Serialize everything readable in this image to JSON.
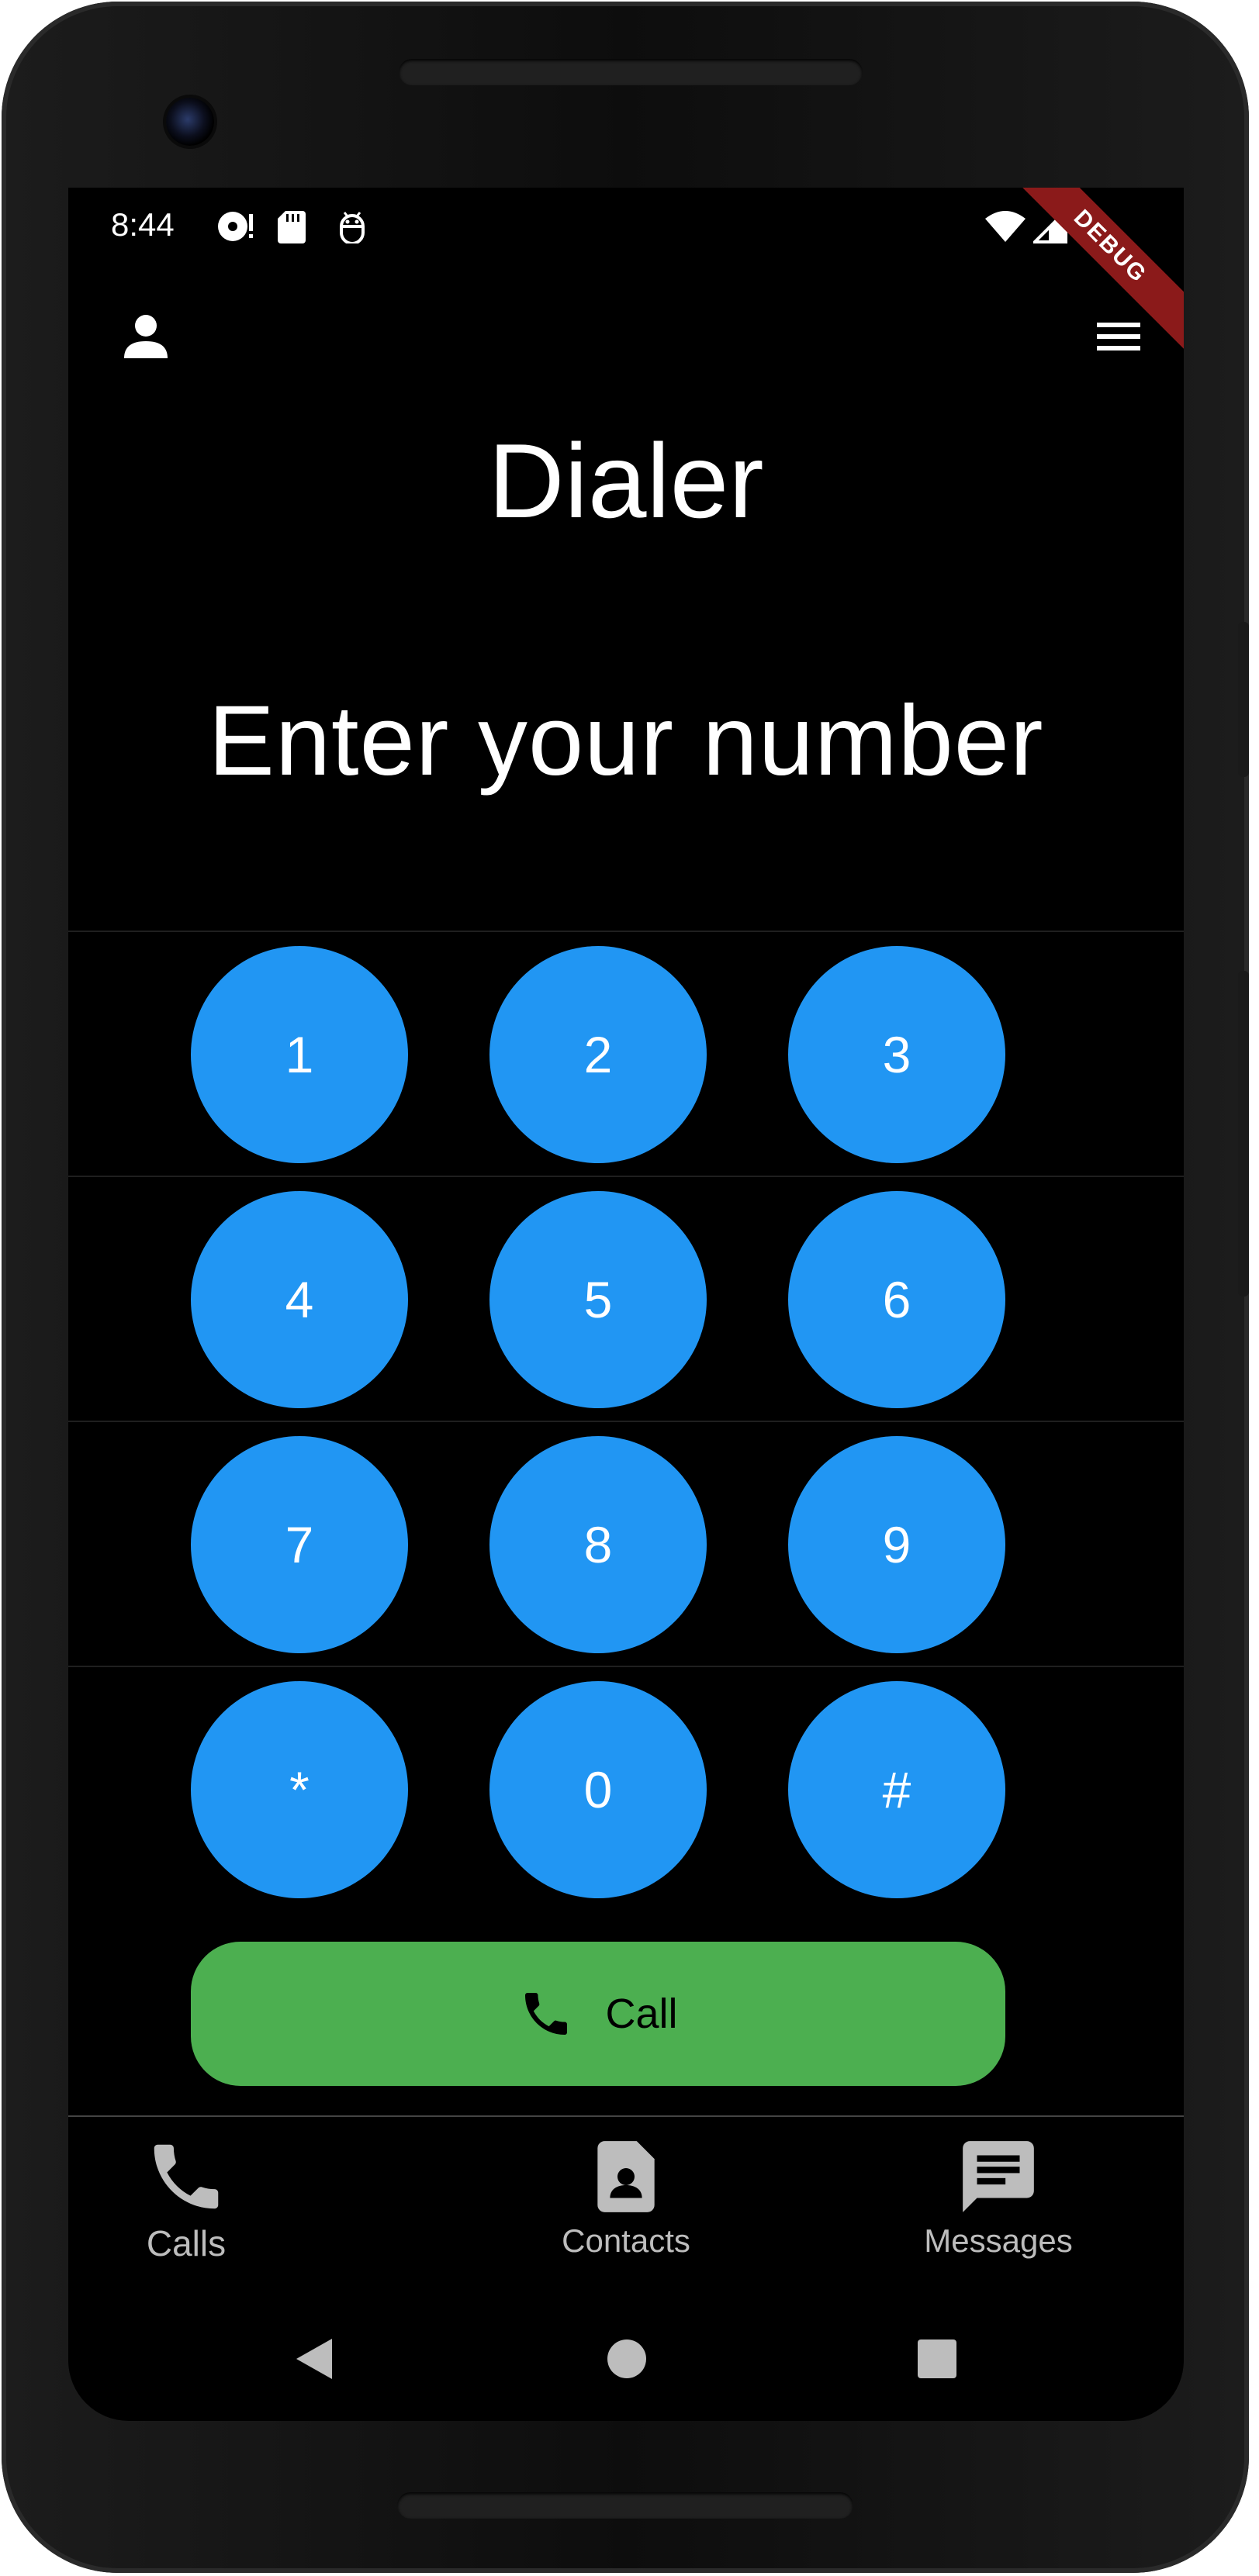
{
  "status_bar": {
    "time": "8:44",
    "debug_label": "DEBUG"
  },
  "app_bar": {
    "left_icon": "person-icon",
    "right_icon": "menu-icon"
  },
  "page": {
    "title": "Dialer",
    "number_placeholder": "Enter your number"
  },
  "keypad": {
    "keys": [
      "1",
      "2",
      "3",
      "4",
      "5",
      "6",
      "7",
      "8",
      "9",
      "*",
      "0",
      "#"
    ]
  },
  "call_button": {
    "label": "Call",
    "icon": "phone-icon"
  },
  "bottom_nav": {
    "items": [
      {
        "label": "Calls",
        "icon": "phone-icon"
      },
      {
        "label": "Contacts",
        "icon": "contact-card-icon"
      },
      {
        "label": "Messages",
        "icon": "message-icon"
      }
    ]
  },
  "system_nav": {
    "back": "back-icon",
    "home": "home-icon",
    "recents": "recents-icon"
  },
  "colors": {
    "background": "#000000",
    "key": "#2196f3",
    "call": "#4caf50",
    "nav_inactive": "#bdbdbd",
    "debug_banner": "#8b1a1a"
  }
}
